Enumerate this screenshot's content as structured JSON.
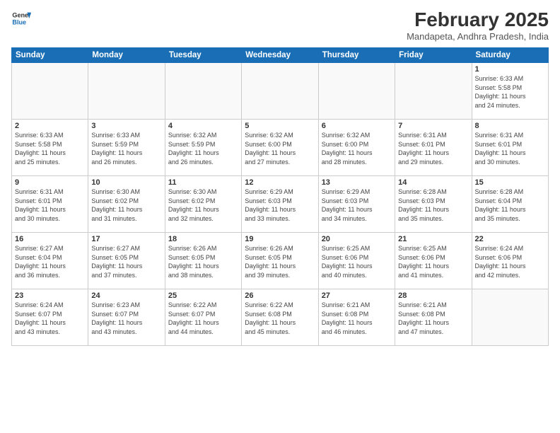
{
  "header": {
    "logo_line1": "General",
    "logo_line2": "Blue",
    "month_year": "February 2025",
    "location": "Mandapeta, Andhra Pradesh, India"
  },
  "days_of_week": [
    "Sunday",
    "Monday",
    "Tuesday",
    "Wednesday",
    "Thursday",
    "Friday",
    "Saturday"
  ],
  "weeks": [
    [
      {
        "day": "",
        "info": ""
      },
      {
        "day": "",
        "info": ""
      },
      {
        "day": "",
        "info": ""
      },
      {
        "day": "",
        "info": ""
      },
      {
        "day": "",
        "info": ""
      },
      {
        "day": "",
        "info": ""
      },
      {
        "day": "1",
        "info": "Sunrise: 6:33 AM\nSunset: 5:58 PM\nDaylight: 11 hours\nand 24 minutes."
      }
    ],
    [
      {
        "day": "2",
        "info": "Sunrise: 6:33 AM\nSunset: 5:58 PM\nDaylight: 11 hours\nand 25 minutes."
      },
      {
        "day": "3",
        "info": "Sunrise: 6:33 AM\nSunset: 5:59 PM\nDaylight: 11 hours\nand 26 minutes."
      },
      {
        "day": "4",
        "info": "Sunrise: 6:32 AM\nSunset: 5:59 PM\nDaylight: 11 hours\nand 26 minutes."
      },
      {
        "day": "5",
        "info": "Sunrise: 6:32 AM\nSunset: 6:00 PM\nDaylight: 11 hours\nand 27 minutes."
      },
      {
        "day": "6",
        "info": "Sunrise: 6:32 AM\nSunset: 6:00 PM\nDaylight: 11 hours\nand 28 minutes."
      },
      {
        "day": "7",
        "info": "Sunrise: 6:31 AM\nSunset: 6:01 PM\nDaylight: 11 hours\nand 29 minutes."
      },
      {
        "day": "8",
        "info": "Sunrise: 6:31 AM\nSunset: 6:01 PM\nDaylight: 11 hours\nand 30 minutes."
      }
    ],
    [
      {
        "day": "9",
        "info": "Sunrise: 6:31 AM\nSunset: 6:01 PM\nDaylight: 11 hours\nand 30 minutes."
      },
      {
        "day": "10",
        "info": "Sunrise: 6:30 AM\nSunset: 6:02 PM\nDaylight: 11 hours\nand 31 minutes."
      },
      {
        "day": "11",
        "info": "Sunrise: 6:30 AM\nSunset: 6:02 PM\nDaylight: 11 hours\nand 32 minutes."
      },
      {
        "day": "12",
        "info": "Sunrise: 6:29 AM\nSunset: 6:03 PM\nDaylight: 11 hours\nand 33 minutes."
      },
      {
        "day": "13",
        "info": "Sunrise: 6:29 AM\nSunset: 6:03 PM\nDaylight: 11 hours\nand 34 minutes."
      },
      {
        "day": "14",
        "info": "Sunrise: 6:28 AM\nSunset: 6:03 PM\nDaylight: 11 hours\nand 35 minutes."
      },
      {
        "day": "15",
        "info": "Sunrise: 6:28 AM\nSunset: 6:04 PM\nDaylight: 11 hours\nand 35 minutes."
      }
    ],
    [
      {
        "day": "16",
        "info": "Sunrise: 6:27 AM\nSunset: 6:04 PM\nDaylight: 11 hours\nand 36 minutes."
      },
      {
        "day": "17",
        "info": "Sunrise: 6:27 AM\nSunset: 6:05 PM\nDaylight: 11 hours\nand 37 minutes."
      },
      {
        "day": "18",
        "info": "Sunrise: 6:26 AM\nSunset: 6:05 PM\nDaylight: 11 hours\nand 38 minutes."
      },
      {
        "day": "19",
        "info": "Sunrise: 6:26 AM\nSunset: 6:05 PM\nDaylight: 11 hours\nand 39 minutes."
      },
      {
        "day": "20",
        "info": "Sunrise: 6:25 AM\nSunset: 6:06 PM\nDaylight: 11 hours\nand 40 minutes."
      },
      {
        "day": "21",
        "info": "Sunrise: 6:25 AM\nSunset: 6:06 PM\nDaylight: 11 hours\nand 41 minutes."
      },
      {
        "day": "22",
        "info": "Sunrise: 6:24 AM\nSunset: 6:06 PM\nDaylight: 11 hours\nand 42 minutes."
      }
    ],
    [
      {
        "day": "23",
        "info": "Sunrise: 6:24 AM\nSunset: 6:07 PM\nDaylight: 11 hours\nand 43 minutes."
      },
      {
        "day": "24",
        "info": "Sunrise: 6:23 AM\nSunset: 6:07 PM\nDaylight: 11 hours\nand 43 minutes."
      },
      {
        "day": "25",
        "info": "Sunrise: 6:22 AM\nSunset: 6:07 PM\nDaylight: 11 hours\nand 44 minutes."
      },
      {
        "day": "26",
        "info": "Sunrise: 6:22 AM\nSunset: 6:08 PM\nDaylight: 11 hours\nand 45 minutes."
      },
      {
        "day": "27",
        "info": "Sunrise: 6:21 AM\nSunset: 6:08 PM\nDaylight: 11 hours\nand 46 minutes."
      },
      {
        "day": "28",
        "info": "Sunrise: 6:21 AM\nSunset: 6:08 PM\nDaylight: 11 hours\nand 47 minutes."
      },
      {
        "day": "",
        "info": ""
      }
    ]
  ]
}
